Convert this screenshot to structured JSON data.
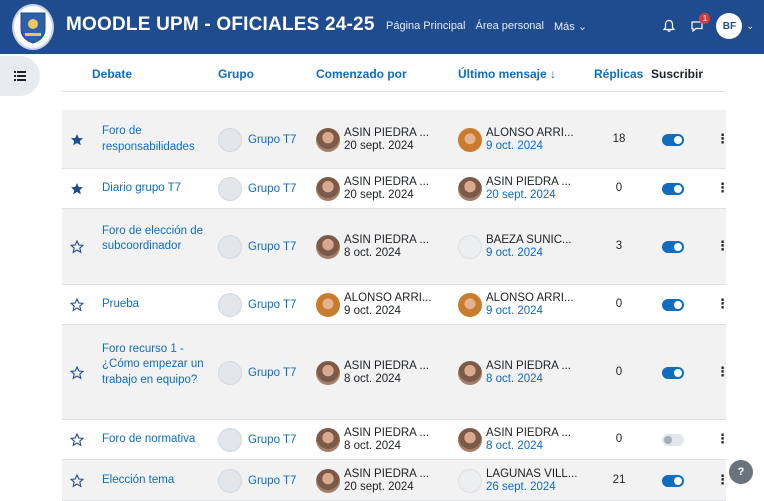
{
  "navbar": {
    "brand": "MOODLE UPM - OFICIALES 24-25",
    "links": [
      "Página Principal",
      "Área personal",
      "Más ⌄"
    ],
    "avatar_initials": "BF",
    "message_badge": "1",
    "color": "#1f4c8f"
  },
  "table": {
    "headers": {
      "debate": "Debate",
      "grupo": "Grupo",
      "comenzado": "Comenzado por",
      "ultimo": "Último mensaje ↓",
      "replicas": "Réplicas",
      "suscribir": "Suscribir"
    },
    "rows": [
      {
        "starred": true,
        "title": "Foro de responsabilidades",
        "group": "Grupo T7",
        "started_name": "ASIN PIEDRA ...",
        "started_date": "20 sept. 2024",
        "started_av": "asin",
        "last_name": "ALONSO ARRI...",
        "last_date": "9 oct. 2024",
        "last_av": "alonso",
        "replies": "18",
        "subscribed": true
      },
      {
        "starred": true,
        "title": "Diario grupo T7",
        "group": "Grupo T7",
        "started_name": "ASIN PIEDRA ...",
        "started_date": "20 sept. 2024",
        "started_av": "asin",
        "last_name": "ASIN PIEDRA ...",
        "last_date": "20 sept. 2024",
        "last_av": "asin",
        "replies": "0",
        "subscribed": true
      },
      {
        "starred": false,
        "title": "Foro de elección de subcoordinador",
        "group": "Grupo T7",
        "started_name": "ASIN PIEDRA ...",
        "started_date": "8 oct. 2024",
        "started_av": "asin",
        "last_name": "BAEZA SUNIC...",
        "last_date": "9 oct. 2024",
        "last_av": "blank",
        "replies": "3",
        "subscribed": true
      },
      {
        "starred": false,
        "title": "Prueba",
        "group": "Grupo T7",
        "started_name": "ALONSO ARRI...",
        "started_date": "9 oct. 2024",
        "started_av": "alonso",
        "last_name": "ALONSO ARRI...",
        "last_date": "9 oct. 2024",
        "last_av": "alonso",
        "replies": "0",
        "subscribed": true
      },
      {
        "starred": false,
        "title": "Foro recurso 1 - ¿Cómo empezar un trabajo en equipo?",
        "group": "Grupo T7",
        "started_name": "ASIN PIEDRA ...",
        "started_date": "8 oct. 2024",
        "started_av": "asin",
        "last_name": "ASIN PIEDRA ...",
        "last_date": "8 oct. 2024",
        "last_av": "asin",
        "replies": "0",
        "subscribed": true
      },
      {
        "starred": false,
        "title": "Foro de normativa",
        "group": "Grupo T7",
        "started_name": "ASIN PIEDRA ...",
        "started_date": "8 oct. 2024",
        "started_av": "asin",
        "last_name": "ASIN PIEDRA ...",
        "last_date": "8 oct. 2024",
        "last_av": "asin",
        "replies": "0",
        "subscribed": false
      },
      {
        "starred": false,
        "title": "Elección tema",
        "group": "Grupo T7",
        "started_name": "ASIN PIEDRA ...",
        "started_date": "20 sept. 2024",
        "started_av": "asin",
        "last_name": "LAGUNAS VILL...",
        "last_date": "26 sept. 2024",
        "last_av": "blank",
        "replies": "21",
        "subscribed": true
      }
    ]
  },
  "help_label": "?"
}
